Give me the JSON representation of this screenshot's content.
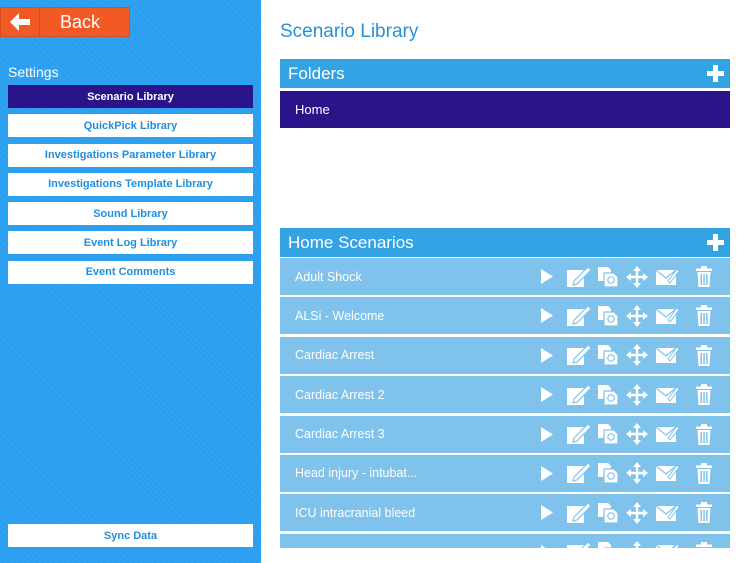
{
  "nav": {
    "back_label": "Back"
  },
  "sidebar": {
    "title": "Settings",
    "items": [
      {
        "label": "Scenario Library",
        "active": true
      },
      {
        "label": "QuickPick Library"
      },
      {
        "label": "Investigations Parameter Library"
      },
      {
        "label": "Investigations Template Library"
      },
      {
        "label": "Sound Library"
      },
      {
        "label": "Event Log Library"
      },
      {
        "label": "Event Comments"
      }
    ],
    "sync_label": "Sync Data"
  },
  "main": {
    "title": "Scenario Library",
    "folders_header": "Folders",
    "folders": [
      {
        "name": "Home"
      }
    ],
    "scenarios_header": "Home Scenarios",
    "scenarios": [
      {
        "name": "Adult Shock"
      },
      {
        "name": "ALSi - Welcome"
      },
      {
        "name": "Cardiac Arrest"
      },
      {
        "name": "Cardiac Arrest 2"
      },
      {
        "name": "Cardiac Arrest 3"
      },
      {
        "name": "Head injury - intubat..."
      },
      {
        "name": "ICU intracranial bleed"
      },
      {
        "name": ""
      }
    ]
  },
  "icons": {
    "back": "left-arrow-icon",
    "add": "plus-icon",
    "play": "play-icon",
    "edit": "edit-icon",
    "duplicate": "duplicate-icon",
    "move": "move-icon",
    "email": "email-icon",
    "delete": "trash-icon"
  },
  "colors": {
    "accent_orange": "#f15a24",
    "active_purple": "#2b1489",
    "header_blue": "#33a3e3",
    "row_blue": "#7fc2ec",
    "sidebar_blue": "#2a9ff0"
  }
}
